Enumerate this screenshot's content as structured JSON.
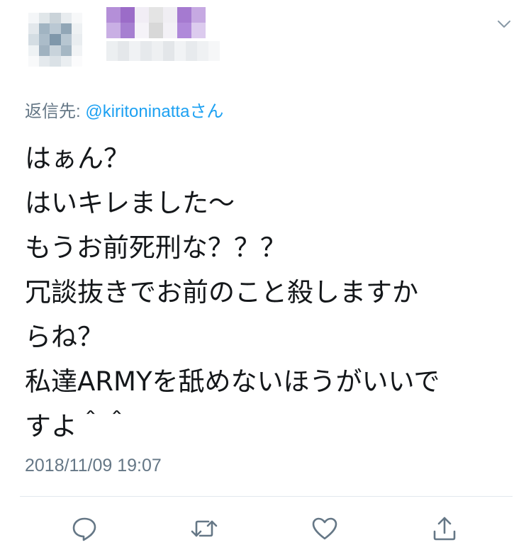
{
  "header": {
    "menu_icon": "chevron-down-icon"
  },
  "reply": {
    "prefix": "返信先: ",
    "mention": "@kiritoninatta",
    "suffix": "さん"
  },
  "tweet": {
    "lines": [
      "はぁん？",
      "はいキレました〜",
      "もうお前死刑な？？？",
      "冗談抜きでお前のこと殺しますか",
      "らね？",
      "私達ARMYを舐めないほうがいいで",
      "すよ＾＾"
    ],
    "timestamp": "2018/11/09 19:07"
  },
  "actions": [
    {
      "name": "reply",
      "icon": "comment-icon"
    },
    {
      "name": "retweet",
      "icon": "retweet-icon"
    },
    {
      "name": "like",
      "icon": "heart-icon"
    },
    {
      "name": "share",
      "icon": "share-icon"
    }
  ],
  "colors": {
    "text": "#14171a",
    "secondary": "#657786",
    "link": "#1da1f2",
    "divider": "#e1e8ed",
    "mosaic_purple": "#9b6cc8"
  }
}
